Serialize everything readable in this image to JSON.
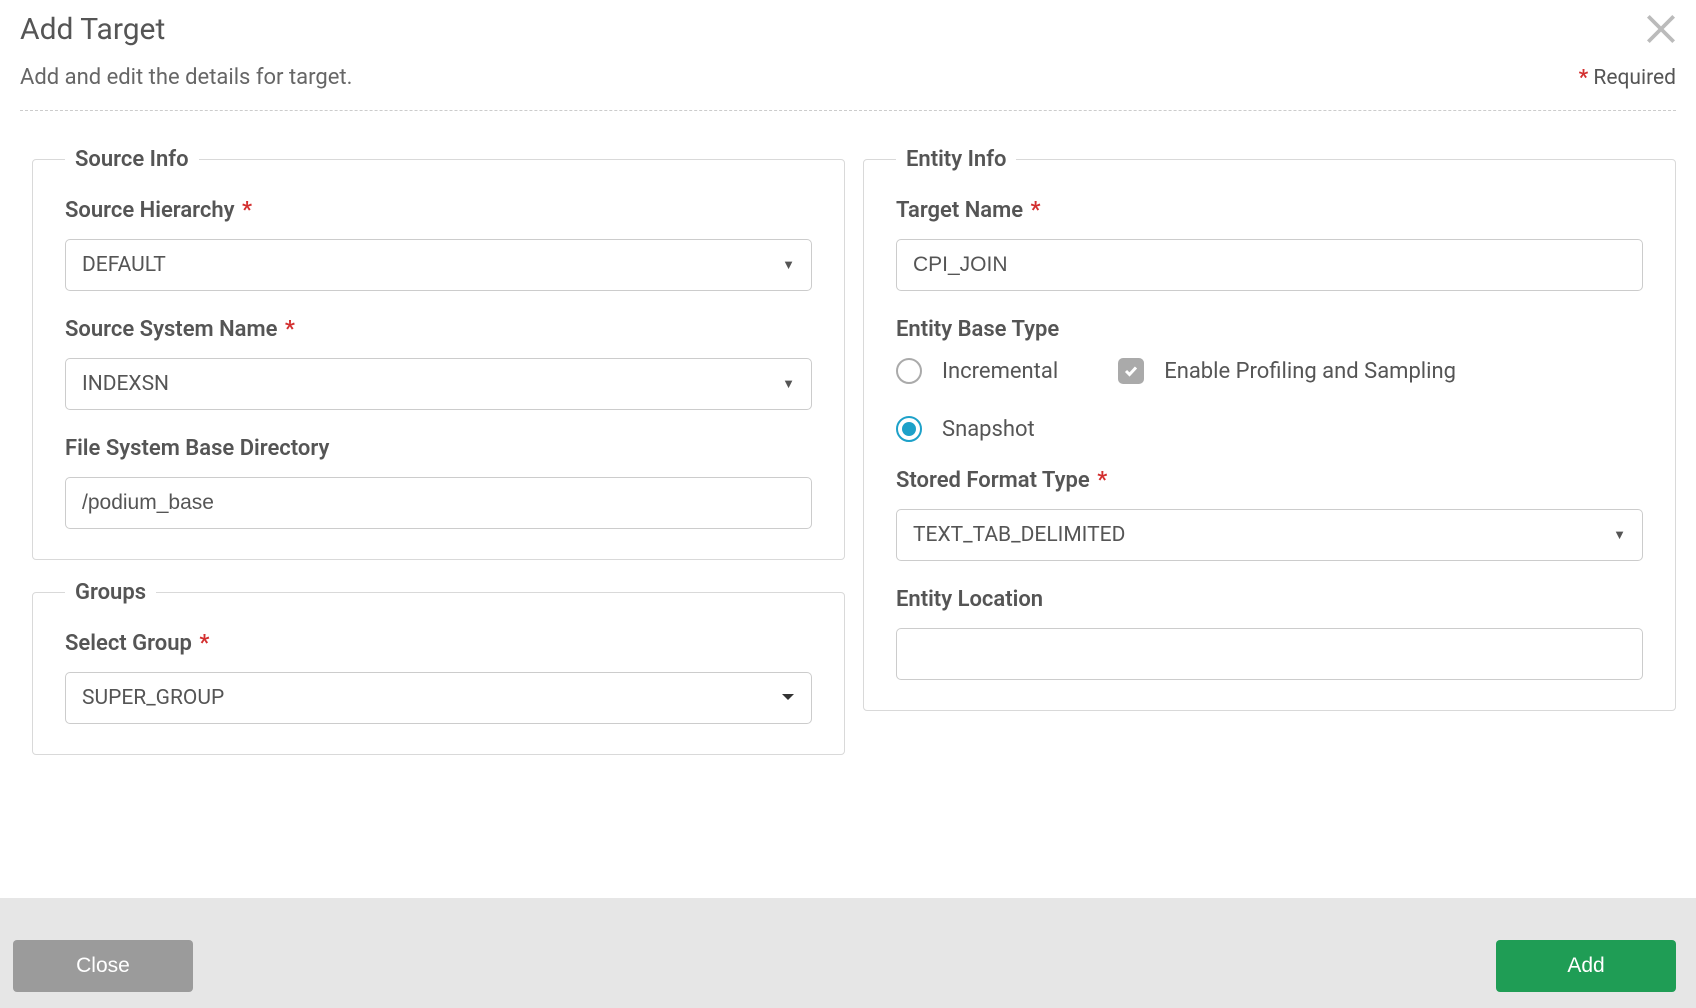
{
  "header": {
    "title": "Add Target",
    "subtitle": "Add and edit the details for target.",
    "required_label": "Required"
  },
  "source_info": {
    "legend": "Source Info",
    "hierarchy_label": "Source Hierarchy",
    "hierarchy_value": "DEFAULT",
    "system_label": "Source System Name",
    "system_value": "INDEXSN",
    "basedir_label": "File System Base Directory",
    "basedir_value": "/podium_base"
  },
  "groups": {
    "legend": "Groups",
    "select_label": "Select Group",
    "select_value": "SUPER_GROUP"
  },
  "entity_info": {
    "legend": "Entity Info",
    "target_name_label": "Target Name",
    "target_name_value": "CPI_JOIN",
    "base_type_label": "Entity Base Type",
    "radio_incremental": "Incremental",
    "radio_snapshot": "Snapshot",
    "enable_profiling_label": "Enable Profiling and Sampling",
    "stored_format_label": "Stored Format Type",
    "stored_format_value": "TEXT_TAB_DELIMITED",
    "entity_location_label": "Entity Location",
    "entity_location_value": ""
  },
  "footer": {
    "close": "Close",
    "add": "Add"
  }
}
